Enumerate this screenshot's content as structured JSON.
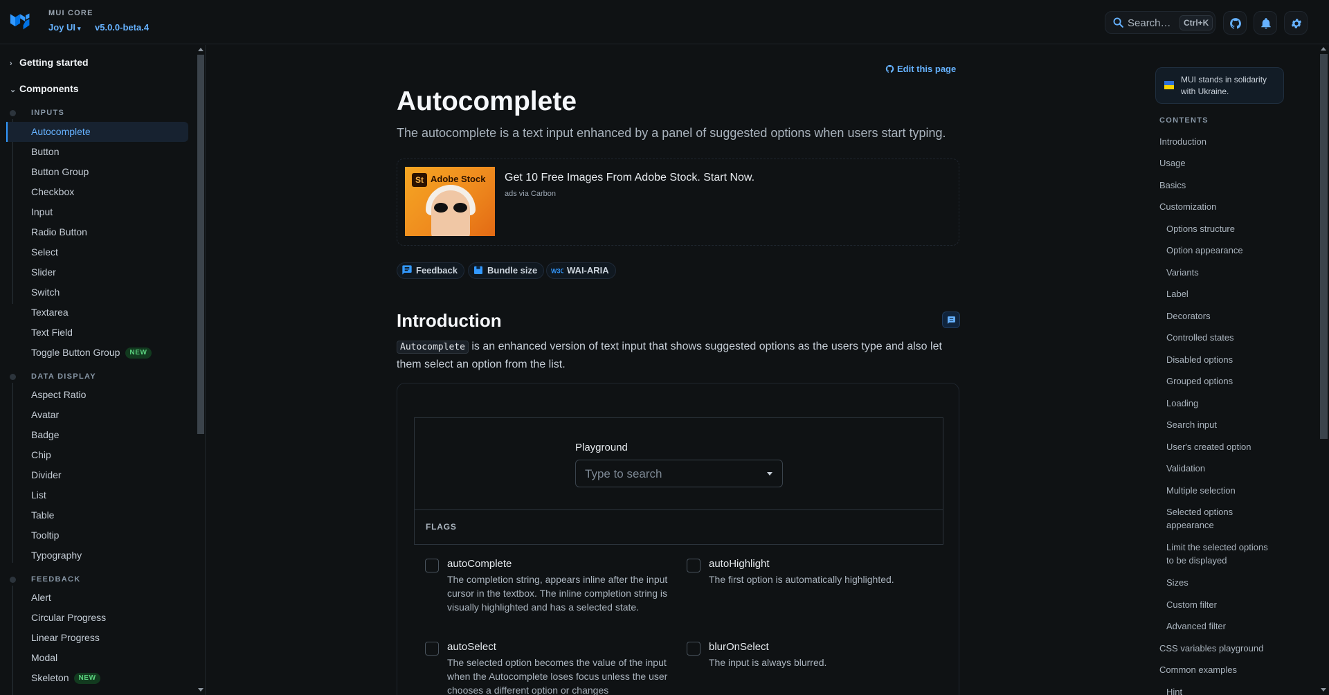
{
  "header": {
    "product_super": "MUI CORE",
    "product_name": "Joy UI",
    "version": "v5.0.0-beta.4",
    "search_label": "Search…",
    "search_shortcut": "Ctrl+K"
  },
  "sidebar": {
    "sections": [
      {
        "label": "Getting started",
        "expanded": false
      },
      {
        "label": "Components",
        "expanded": true
      }
    ],
    "categories": [
      {
        "label": "INPUTS",
        "items": [
          {
            "label": "Autocomplete",
            "active": true
          },
          {
            "label": "Button"
          },
          {
            "label": "Button Group"
          },
          {
            "label": "Checkbox"
          },
          {
            "label": "Input"
          },
          {
            "label": "Radio Button"
          },
          {
            "label": "Select"
          },
          {
            "label": "Slider"
          },
          {
            "label": "Switch"
          },
          {
            "label": "Textarea"
          },
          {
            "label": "Text Field"
          },
          {
            "label": "Toggle Button Group",
            "badge": "NEW"
          }
        ]
      },
      {
        "label": "DATA DISPLAY",
        "items": [
          {
            "label": "Aspect Ratio"
          },
          {
            "label": "Avatar"
          },
          {
            "label": "Badge"
          },
          {
            "label": "Chip"
          },
          {
            "label": "Divider"
          },
          {
            "label": "List"
          },
          {
            "label": "Table"
          },
          {
            "label": "Tooltip"
          },
          {
            "label": "Typography"
          }
        ]
      },
      {
        "label": "FEEDBACK",
        "items": [
          {
            "label": "Alert"
          },
          {
            "label": "Circular Progress"
          },
          {
            "label": "Linear Progress"
          },
          {
            "label": "Modal"
          },
          {
            "label": "Skeleton",
            "badge": "NEW"
          }
        ]
      }
    ]
  },
  "main": {
    "edit_link": "Edit this page",
    "title": "Autocomplete",
    "description": "The autocomplete is a text input enhanced by a panel of suggested options when users start typing.",
    "ad": {
      "brand": "Adobe Stock",
      "brand_mark": "St",
      "text": "Get 10 Free Images From Adobe Stock. Start Now.",
      "via": "ads via Carbon"
    },
    "chips": [
      {
        "label": "Feedback",
        "icon": "feedback-icon"
      },
      {
        "label": "Bundle size",
        "icon": "package-icon"
      },
      {
        "label": "WAI-ARIA",
        "icon": "w3c-icon"
      }
    ],
    "intro": {
      "title": "Introduction",
      "code": "Autocomplete",
      "text": " is an enhanced version of text input that shows suggested options as the users type and also let them select an option from the list."
    },
    "demo": {
      "label": "Playground",
      "placeholder": "Type to search",
      "flags_header": "FLAGS",
      "flags": [
        {
          "name": "autoComplete",
          "desc": "The completion string, appears inline after the input cursor in the textbox. The inline completion string is visually highlighted and has a selected state."
        },
        {
          "name": "autoHighlight",
          "desc": "The first option is automatically highlighted."
        },
        {
          "name": "autoSelect",
          "desc": "The selected option becomes the value of the input when the Autocomplete loses focus unless the user chooses a different option or changes"
        },
        {
          "name": "blurOnSelect",
          "desc": "The input is always blurred."
        }
      ]
    }
  },
  "toc": {
    "ukraine_banner": "MUI stands in solidarity with Ukraine.",
    "heading": "CONTENTS",
    "items": [
      {
        "label": "Introduction",
        "level": 1
      },
      {
        "label": "Usage",
        "level": 1
      },
      {
        "label": "Basics",
        "level": 1
      },
      {
        "label": "Customization",
        "level": 1
      },
      {
        "label": "Options structure",
        "level": 2
      },
      {
        "label": "Option appearance",
        "level": 2
      },
      {
        "label": "Variants",
        "level": 2
      },
      {
        "label": "Label",
        "level": 2
      },
      {
        "label": "Decorators",
        "level": 2
      },
      {
        "label": "Controlled states",
        "level": 2
      },
      {
        "label": "Disabled options",
        "level": 2
      },
      {
        "label": "Grouped options",
        "level": 2
      },
      {
        "label": "Loading",
        "level": 2
      },
      {
        "label": "Search input",
        "level": 2
      },
      {
        "label": "User's created option",
        "level": 2
      },
      {
        "label": "Validation",
        "level": 2
      },
      {
        "label": "Multiple selection",
        "level": 2
      },
      {
        "label": "Selected options appearance",
        "level": 2
      },
      {
        "label": "Limit the selected options to be displayed",
        "level": 2
      },
      {
        "label": "Sizes",
        "level": 2
      },
      {
        "label": "Custom filter",
        "level": 2
      },
      {
        "label": "Advanced filter",
        "level": 2
      },
      {
        "label": "CSS variables playground",
        "level": 1
      },
      {
        "label": "Common examples",
        "level": 1
      },
      {
        "label": "Hint",
        "level": 2
      }
    ]
  },
  "colors": {
    "background": "#0f1214",
    "accent": "#66b2ff",
    "active_bg": "#172230",
    "new_badge": "#5ad17e"
  }
}
